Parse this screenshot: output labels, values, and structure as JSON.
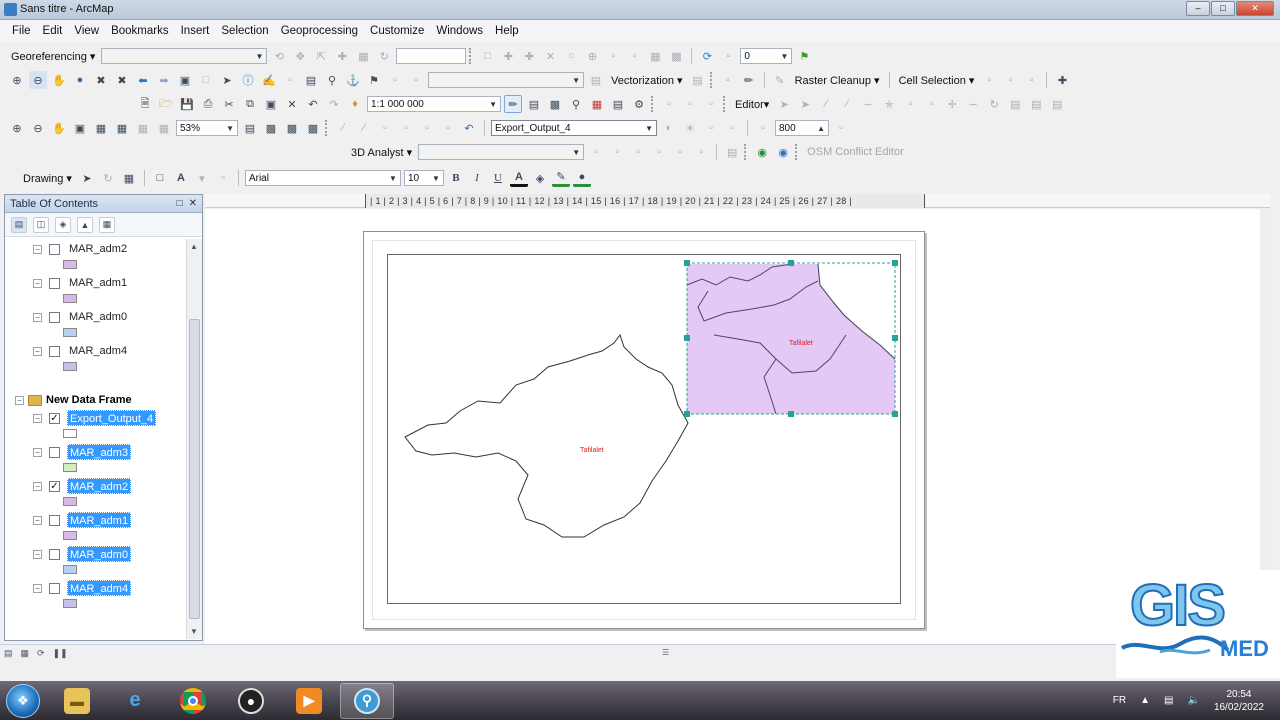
{
  "window": {
    "title": "Sans titre - ArcMap"
  },
  "menu": [
    "File",
    "Edit",
    "View",
    "Bookmarks",
    "Insert",
    "Selection",
    "Geoprocessing",
    "Customize",
    "Windows",
    "Help"
  ],
  "toolbars": {
    "georeferencing_label": "Georeferencing ▾",
    "georef_value": "0",
    "vectorization_label": "Vectorization ▾",
    "raster_cleanup_label": "Raster Cleanup ▾",
    "cell_selection_label": "Cell Selection ▾",
    "scale_value": "1:1 000 000",
    "editor_label": "Editor▾",
    "zoom_value": "53%",
    "target_layer": "Export_Output_4",
    "resolution_value": "800",
    "analyst_label": "3D Analyst ▾",
    "osm_label": "OSM Conflict Editor",
    "drawing_label": "Drawing ▾",
    "font_name": "Arial",
    "font_size": "10",
    "bold": "B",
    "italic": "I",
    "underline": "U",
    "font_color_glyph": "A"
  },
  "ruler": {
    "text": "| 1 | 2 | 3 | 4 | 5 | 6 | 7 | 8 | 9 | 10 | 11 | 12 | 13 | 14 | 15 | 16 | 17 | 18 | 19 | 20 | 21 | 22 | 23 | 24 | 25 | 26 | 27 | 28 |"
  },
  "toc": {
    "title": "Table Of Contents",
    "top_layers": [
      {
        "name": "MAR_adm2",
        "checked": false,
        "swatch": "#d9b8ea"
      },
      {
        "name": "MAR_adm1",
        "checked": false,
        "swatch": "#d9b8ea"
      },
      {
        "name": "MAR_adm0",
        "checked": false,
        "swatch": "#b9d0ee"
      },
      {
        "name": "MAR_adm4",
        "checked": false,
        "swatch": "#c8c0ea"
      }
    ],
    "data_frame": "New Data Frame",
    "frame_layers": [
      {
        "name": "Export_Output_4",
        "checked": true,
        "swatch": "#ffffff"
      },
      {
        "name": "MAR_adm3",
        "checked": false,
        "swatch": "#d2eec0"
      },
      {
        "name": "MAR_adm2",
        "checked": true,
        "swatch": "#d9b8ea"
      },
      {
        "name": "MAR_adm1",
        "checked": false,
        "swatch": "#d9b8ea"
      },
      {
        "name": "MAR_adm0",
        "checked": false,
        "swatch": "#b9d0ee"
      },
      {
        "name": "MAR_adm4",
        "checked": false,
        "swatch": "#c8c0ea"
      }
    ]
  },
  "map": {
    "label_main": "Tafilalet",
    "label_inset": "Tafilalet",
    "inset_fill": "#e4c8f5",
    "selection_color": "#2aa198"
  },
  "taskbar": {
    "language": "FR",
    "time": "20:54",
    "date": "16/02/2022"
  },
  "watermark": {
    "big": "GIS",
    "small": "MED"
  }
}
